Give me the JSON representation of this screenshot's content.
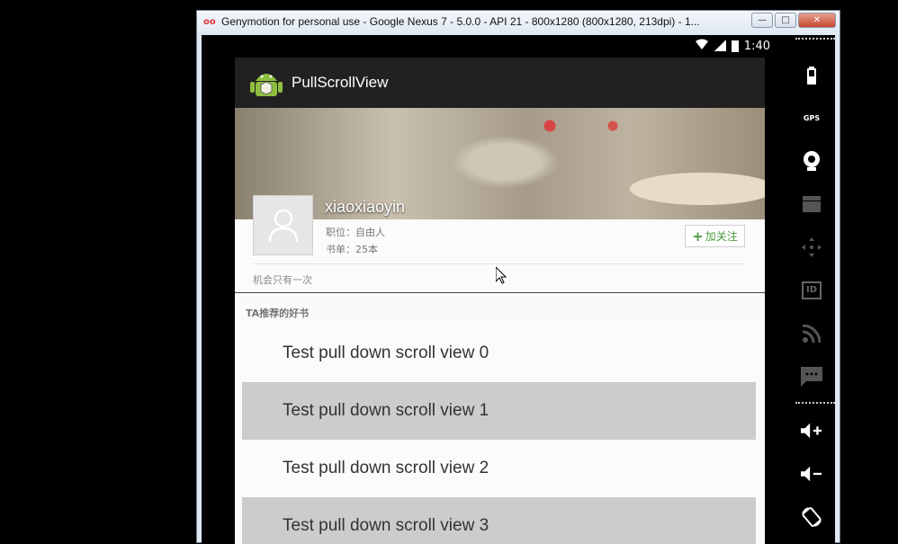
{
  "window": {
    "title": "Genymotion for personal use - Google Nexus 7 - 5.0.0 - API 21 - 800x1280 (800x1280, 213dpi) - 1...",
    "logo": "oo",
    "buttons": {
      "minimize": "minimize-icon",
      "maximize": "maximize-icon",
      "close": "close-icon"
    }
  },
  "statusbar": {
    "time": "1:40",
    "wifi_icon": "wifi-icon",
    "signal_icon": "signal-icon",
    "battery_icon": "battery-icon"
  },
  "app": {
    "title": "PullScrollView",
    "logo_icon": "android-robot-icon",
    "profile": {
      "username": "xiaoxiaoyin",
      "job": "职位：自由人",
      "books": "书单：25本",
      "follow_label": "加关注",
      "motto": "机会只有一次"
    },
    "section_label": "TA推荐的好书",
    "list": [
      "Test pull down scroll view 0",
      "Test pull down scroll view 1",
      "Test pull down scroll view 2",
      "Test pull down scroll view 3"
    ]
  },
  "sidebar": {
    "icons": [
      "battery-icon",
      "gps-icon",
      "camera-icon",
      "media-icon",
      "dpad-icon",
      "id-icon",
      "rss-icon",
      "sms-icon",
      "volume-up-icon",
      "volume-down-icon",
      "rotate-icon"
    ],
    "gps_text": "GPS",
    "id_text": "ID"
  },
  "colors": {
    "actionbar": "#212121",
    "accent_green": "#4a9a3a",
    "gray_row": "#cccccc"
  }
}
